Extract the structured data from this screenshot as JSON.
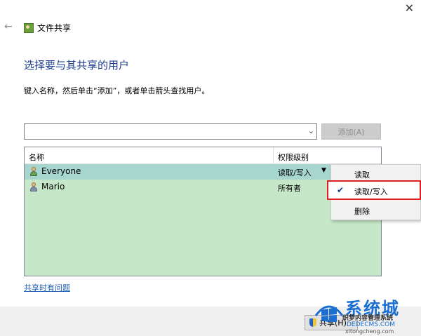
{
  "window": {
    "close_glyph": "✕",
    "back_glyph": "←"
  },
  "header": {
    "title": "文件共享",
    "icon": "share-folder-icon"
  },
  "main": {
    "heading": "选择要与其共享的用户",
    "instruction": "键入名称，然后单击“添加”，或者单击箭头查找用户。",
    "combo_value": "",
    "add_button": "添加(A)"
  },
  "list": {
    "columns": [
      "名称",
      "权限级别"
    ],
    "rows": [
      {
        "name": "Everyone",
        "permission": "读取/写入",
        "icon": "group-user-icon",
        "selected": true
      },
      {
        "name": "Mario",
        "permission": "所有者",
        "icon": "user-icon",
        "selected": false
      }
    ]
  },
  "menu": {
    "items": [
      {
        "label": "读取",
        "checked": false
      },
      {
        "label": "读取/写入",
        "checked": true
      },
      {
        "label": "删除",
        "checked": false
      }
    ]
  },
  "help_link": "共享时有问题",
  "footer": {
    "share_button": "共享(H)"
  },
  "watermark": {
    "brand": "系统城",
    "subtitle": "织梦内容管理系统",
    "url": "DEDECMS.COM",
    "url2": "xitongcheng.com"
  },
  "colors": {
    "heading": "#1e3d8c",
    "list_bg": "#c6e8c8",
    "selected_row": "#a7d6cf",
    "highlight_border": "#e02020"
  }
}
